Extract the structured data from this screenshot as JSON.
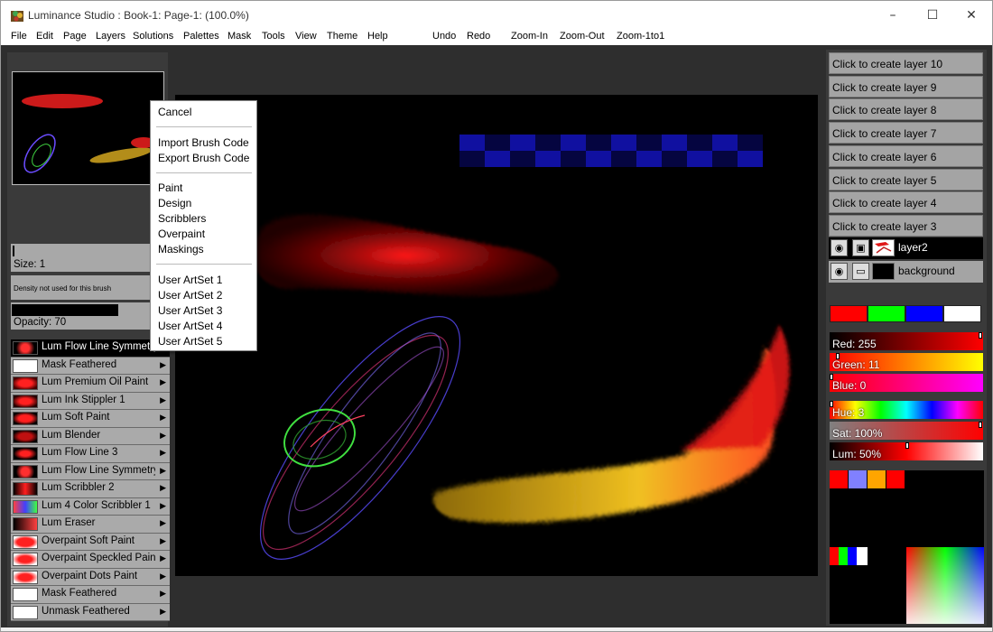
{
  "window": {
    "title": "Luminance Studio : Book-1: Page-1:  (100.0%)",
    "minimize": "–",
    "maximize": "☐",
    "close": "✕"
  },
  "menubar": {
    "items": [
      "File",
      "Edit",
      "Page",
      "Layers",
      "Solutions",
      "Palettes",
      "Mask",
      "Tools",
      "View",
      "Theme",
      "Help"
    ],
    "actions": [
      "Undo",
      "Redo",
      "Zoom-In",
      "Zoom-Out",
      "Zoom-1to1"
    ]
  },
  "brush_settings": {
    "size": "Size: 1",
    "density": "Density not used for this brush",
    "opacity": "Opacity: 70"
  },
  "brushes": [
    {
      "label": "Lum Flow Line Symmetry",
      "selected": true
    },
    {
      "label": "Mask Feathered"
    },
    {
      "label": "Lum Premium Oil Paint"
    },
    {
      "label": "Lum Ink Stippler 1"
    },
    {
      "label": "Lum Soft Paint"
    },
    {
      "label": "Lum Blender"
    },
    {
      "label": "Lum Flow Line 3"
    },
    {
      "label": "Lum Flow Line Symmetry"
    },
    {
      "label": "Lum Scribbler 2"
    },
    {
      "label": "Lum 4 Color Scribbler 1"
    },
    {
      "label": "Lum Eraser"
    },
    {
      "label": "Overpaint Soft Paint"
    },
    {
      "label": "Overpaint Speckled Paint"
    },
    {
      "label": "Overpaint Dots Paint"
    },
    {
      "label": "Mask Feathered"
    },
    {
      "label": "Unmask Feathered"
    }
  ],
  "context_menu": {
    "cancel": "Cancel",
    "import": "Import Brush Code",
    "export": "Export Brush Code",
    "categories": [
      "Paint",
      "Design",
      "Scribblers",
      "Overpaint",
      "Maskings"
    ],
    "artsets": [
      "User ArtSet 1",
      "User ArtSet 2",
      "User ArtSet 3",
      "User ArtSet 4",
      "User ArtSet 5"
    ]
  },
  "layers": {
    "create_buttons": [
      "Click to create layer 10",
      "Click to create layer 9",
      "Click to create layer 8",
      "Click to create layer 7",
      "Click to create layer 6",
      "Click to create layer 5",
      "Click to create layer 4",
      "Click to create layer 3"
    ],
    "existing": [
      "layer2",
      "background"
    ]
  },
  "colors": {
    "swatches": [
      "#ff0000",
      "#00ff00",
      "#0000ff",
      "#ffffff"
    ],
    "red": "Red: 255",
    "green": "Green: 11",
    "blue": "Blue: 0",
    "hue": "Hue: 3",
    "sat": "Sat: 100%",
    "lum": "Lum: 50%",
    "palette_top": [
      "#ff0000",
      "#8080ff",
      "#ffa500",
      "#ff0000"
    ],
    "palette_small": [
      "#ff0000",
      "#00ff00",
      "#0000ff",
      "#ffffff"
    ]
  }
}
